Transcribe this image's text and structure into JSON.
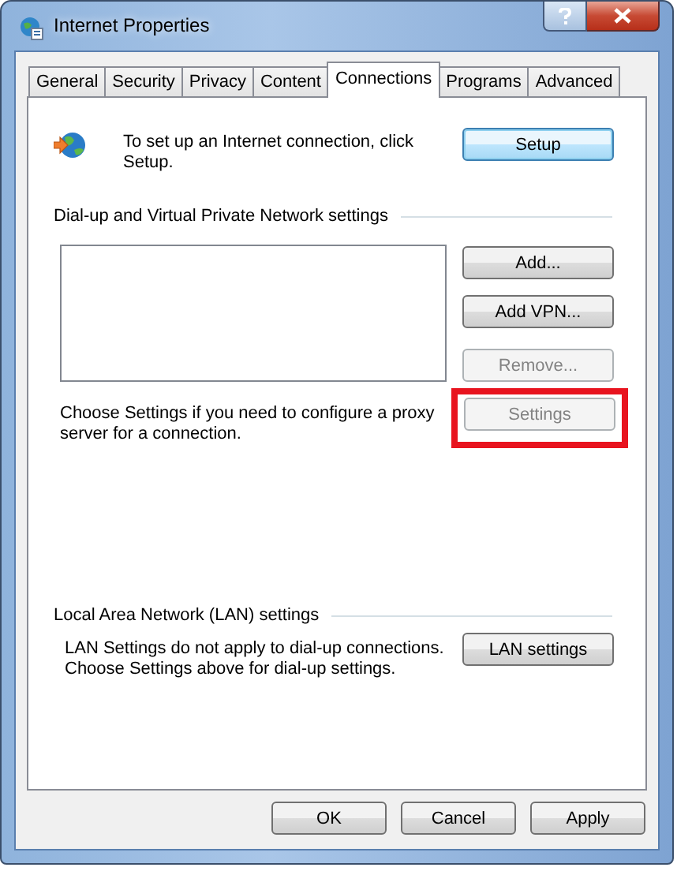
{
  "window": {
    "title": "Internet Properties"
  },
  "tabs": [
    {
      "label": "General",
      "selected": false
    },
    {
      "label": "Security",
      "selected": false
    },
    {
      "label": "Privacy",
      "selected": false
    },
    {
      "label": "Content",
      "selected": false
    },
    {
      "label": "Connections",
      "selected": true
    },
    {
      "label": "Programs",
      "selected": false
    },
    {
      "label": "Advanced",
      "selected": false
    }
  ],
  "setup": {
    "text": "To set up an Internet connection, click\nSetup.",
    "button": "Setup"
  },
  "dialup": {
    "heading": "Dial-up and Virtual Private Network settings",
    "buttons": [
      {
        "label": "Add...",
        "disabled": false
      },
      {
        "label": "Add VPN...",
        "disabled": false
      },
      {
        "label": "Remove...",
        "disabled": true
      }
    ],
    "proxy_note": "Choose Settings if you need to configure a proxy\nserver for a connection.",
    "settings_button": {
      "label": "Settings",
      "disabled": true,
      "highlighted": true
    }
  },
  "lan": {
    "heading": "Local Area Network (LAN) settings",
    "note": "LAN Settings do not apply to dial-up connections.\nChoose Settings above for dial-up settings.",
    "button": "LAN settings"
  },
  "dialog_buttons": [
    {
      "label": "OK"
    },
    {
      "label": "Cancel"
    },
    {
      "label": "Apply"
    }
  ]
}
